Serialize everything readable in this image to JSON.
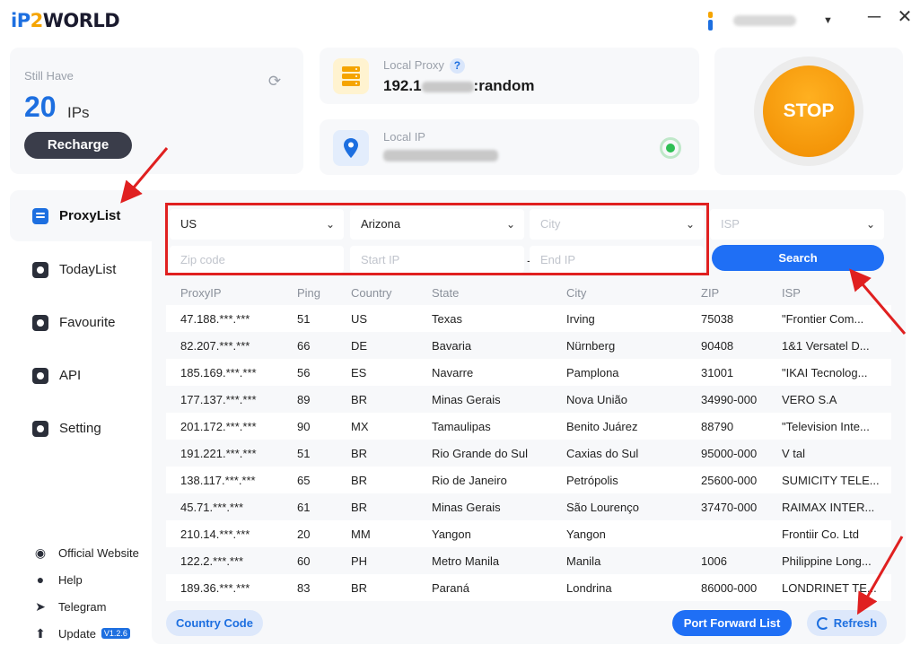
{
  "app": {
    "logo_ip": "iP",
    "logo_2": "2",
    "logo_world": "WORLD",
    "minimize_icon": "─",
    "close_icon": "✕",
    "user_caret": "▼"
  },
  "ips_card": {
    "label": "Still Have",
    "count": "20",
    "unit": "IPs",
    "refresh_icon": "⟳",
    "recharge_label": "Recharge"
  },
  "local_proxy": {
    "label": "Local Proxy",
    "help": "?",
    "value_prefix": "192.1",
    "value_suffix": ":random"
  },
  "local_ip": {
    "label": "Local IP"
  },
  "stop_label": "STOP",
  "sidebar": {
    "items": [
      {
        "label": "ProxyList",
        "icon": "proxylist-icon"
      },
      {
        "label": "TodayList",
        "icon": "todaylist-icon"
      },
      {
        "label": "Favourite",
        "icon": "favourite-icon"
      },
      {
        "label": "API",
        "icon": "api-icon"
      },
      {
        "label": "Setting",
        "icon": "setting-icon"
      }
    ],
    "footer": [
      {
        "label": "Official Website",
        "glyph": "◉"
      },
      {
        "label": "Help",
        "glyph": "●"
      },
      {
        "label": "Telegram",
        "glyph": "➤"
      },
      {
        "label": "Update",
        "glyph": "⬆"
      }
    ],
    "version": "V1.2.6"
  },
  "filters": {
    "country": "US",
    "state": "Arizona",
    "city_placeholder": "City",
    "isp_placeholder": "ISP",
    "caret": "⌄",
    "zip_placeholder": "Zip code",
    "start_ip_placeholder": "Start IP",
    "dash": "-",
    "end_ip_placeholder": "End IP",
    "search_label": "Search"
  },
  "table": {
    "headers": [
      "ProxyIP",
      "Ping",
      "Country",
      "State",
      "City",
      "ZIP",
      "ISP"
    ],
    "rows": [
      [
        "47.188.***.***",
        "51",
        "US",
        "Texas",
        "Irving",
        "75038",
        "\"Frontier Com..."
      ],
      [
        "82.207.***.***",
        "66",
        "DE",
        "Bavaria",
        "Nürnberg",
        "90408",
        "1&1 Versatel D..."
      ],
      [
        "185.169.***.***",
        "56",
        "ES",
        "Navarre",
        "Pamplona",
        "31001",
        "\"IKAI Tecnolog..."
      ],
      [
        "177.137.***.***",
        "89",
        "BR",
        "Minas Gerais",
        "Nova União",
        "34990-000",
        "VERO S.A"
      ],
      [
        "201.172.***.***",
        "90",
        "MX",
        "Tamaulipas",
        "Benito Juárez",
        "88790",
        "\"Television Inte..."
      ],
      [
        "191.221.***.***",
        "51",
        "BR",
        "Rio Grande do Sul",
        "Caxias do Sul",
        "95000-000",
        "V tal"
      ],
      [
        "138.117.***.***",
        "65",
        "BR",
        "Rio de Janeiro",
        "Petrópolis",
        "25600-000",
        "SUMICITY TELE..."
      ],
      [
        "45.71.***.***",
        "61",
        "BR",
        "Minas Gerais",
        "São Lourenço",
        "37470-000",
        "RAIMAX INTER..."
      ],
      [
        "210.14.***.***",
        "20",
        "MM",
        "Yangon",
        "Yangon",
        "",
        "Frontiir Co. Ltd"
      ],
      [
        "122.2.***.***",
        "60",
        "PH",
        "Metro Manila",
        "Manila",
        "1006",
        "Philippine Long..."
      ],
      [
        "189.36.***.***",
        "83",
        "BR",
        "Paraná",
        "Londrina",
        "86000-000",
        "LONDRINET TE..."
      ]
    ]
  },
  "buttons": {
    "country_code": "Country Code",
    "port_forward": "Port Forward List",
    "refresh": "Refresh"
  },
  "annotation_color": "#e02020",
  "accent_color": "#1d6fe0"
}
